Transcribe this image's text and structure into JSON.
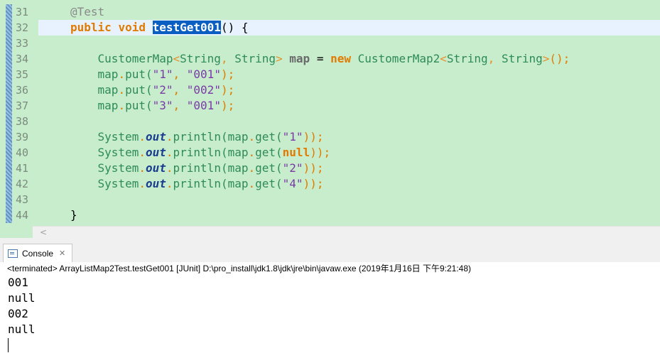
{
  "editor": {
    "line_numbers": [
      "31",
      "32",
      "33",
      "34",
      "35",
      "36",
      "37",
      "38",
      "39",
      "40",
      "41",
      "42",
      "43",
      "44"
    ],
    "lines": {
      "l31": {
        "anno": "@Test"
      },
      "l32": {
        "kw1": "public",
        "kw2": "void",
        "method": "testGet001",
        "rest": "() {"
      },
      "l34": {
        "t1": "CustomerMap",
        "g1": "<",
        "t2": "String",
        "c1": ", ",
        "t3": "String",
        "g2": ">",
        "var": "map",
        "eq": " = ",
        "kw": "new",
        "t4": "CustomerMap2",
        "g3": "<",
        "t5": "String",
        "c2": ", ",
        "t6": "String",
        "g4": ">",
        "end": "();"
      },
      "l35": {
        "obj": "map",
        "dot": ".",
        "call": "put(",
        "s1": "\"1\"",
        "comma": ", ",
        "s2": "\"001\"",
        "close": ");"
      },
      "l36": {
        "obj": "map",
        "dot": ".",
        "call": "put(",
        "s1": "\"2\"",
        "comma": ", ",
        "s2": "\"002\"",
        "close": ");"
      },
      "l37": {
        "obj": "map",
        "dot": ".",
        "call": "put(",
        "s1": "\"3\"",
        "comma": ", ",
        "s2": "\"001\"",
        "close": ");"
      },
      "l39": {
        "cls": "System",
        "dot": ".",
        "fld": "out",
        "dot2": ".",
        "call": "println(",
        "obj": "map",
        "dot3": ".",
        "get": "get(",
        "arg": "\"1\"",
        "close": "));"
      },
      "l40": {
        "cls": "System",
        "dot": ".",
        "fld": "out",
        "dot2": ".",
        "call": "println(",
        "obj": "map",
        "dot3": ".",
        "get": "get(",
        "arg": "null",
        "close": "));"
      },
      "l41": {
        "cls": "System",
        "dot": ".",
        "fld": "out",
        "dot2": ".",
        "call": "println(",
        "obj": "map",
        "dot3": ".",
        "get": "get(",
        "arg": "\"2\"",
        "close": "));"
      },
      "l42": {
        "cls": "System",
        "dot": ".",
        "fld": "out",
        "dot2": ".",
        "call": "println(",
        "obj": "map",
        "dot3": ".",
        "get": "get(",
        "arg": "\"4\"",
        "close": "));"
      },
      "l44": {
        "brace": "}"
      }
    }
  },
  "scrollbar": {
    "left_arrow": "<"
  },
  "console": {
    "tab_label": "Console",
    "close_glyph": "✕",
    "status": "<terminated> ArrayListMap2Test.testGet001 [JUnit] D:\\pro_install\\jdk1.8\\jdk\\jre\\bin\\javaw.exe (2019年1月16日 下午9:21:48)",
    "output": [
      "001",
      "null",
      "002",
      "null"
    ]
  },
  "colors": {
    "editor_bg": "#c7edcc",
    "selection": "#0a5ec2",
    "keyword": "#e07a00",
    "string": "#7a3aa6",
    "type": "#2e8b57"
  }
}
